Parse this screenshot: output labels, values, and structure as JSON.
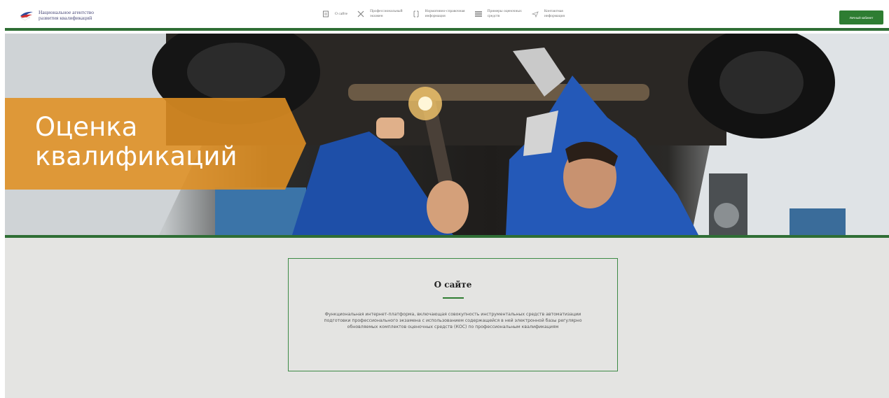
{
  "header": {
    "logo_line1": "Национальное агентство",
    "logo_line2": "развития квалификаций",
    "nav": [
      {
        "label": "О сайте",
        "icon": "document-icon"
      },
      {
        "label": "Профессиональный\nэкзамен",
        "icon": "tools-icon"
      },
      {
        "label": "Нормативно-справочная\nинформация",
        "icon": "book-icon"
      },
      {
        "label": "Примеры оценочных\nсредств",
        "icon": "stack-icon"
      },
      {
        "label": "Контактная\nинформация",
        "icon": "send-icon"
      }
    ],
    "cabinet_button": "Личный кабинет"
  },
  "hero": {
    "title": "Оценка\nквалификаций"
  },
  "about": {
    "title": "О сайте",
    "text": "Функциональная интернет-платформа, включающая совокупность инструментальных средств автоматизации подготовки профессионального экзамена с использованием содержащейся в ней электронной базы регулярно обновляемых комплектов оценочных средств (КОС) по профессиональным квалификациям"
  },
  "colors": {
    "accent_green": "#2e7d32",
    "hero_band_orange": "#e09022",
    "content_bg": "#e4e4e2"
  }
}
